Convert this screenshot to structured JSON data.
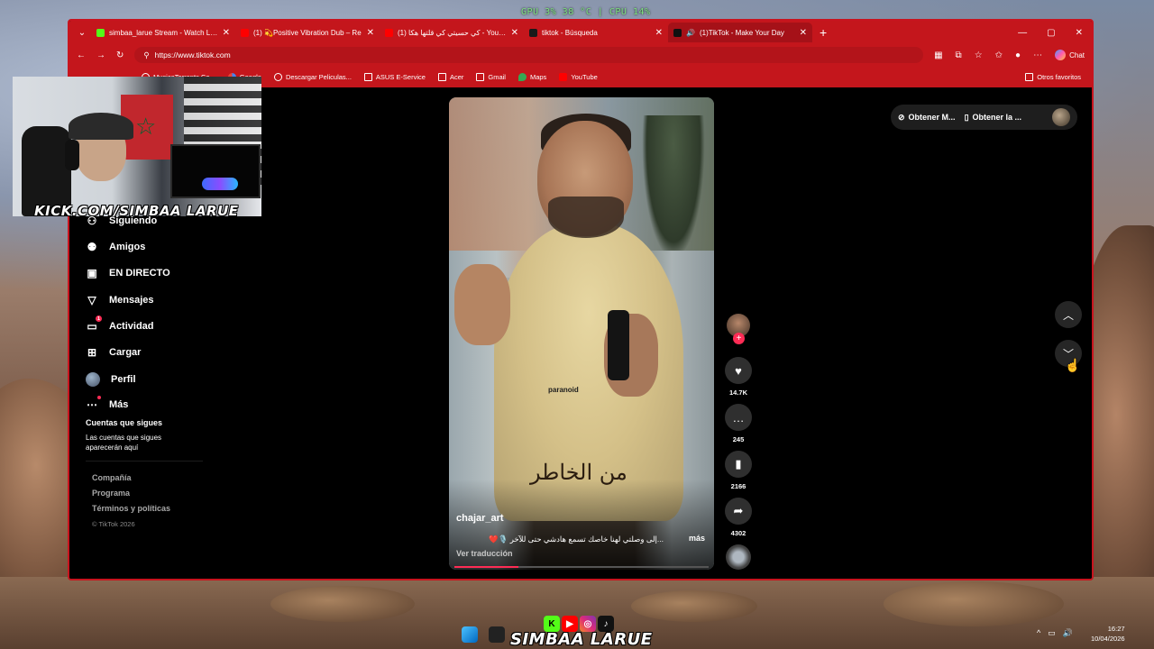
{
  "overlay": {
    "gpu_label": "GPU",
    "gpu_value": "3%",
    "gpu_temp": "38 °C",
    "cpu_label": "CPU",
    "cpu_value": "14%"
  },
  "browser": {
    "tabs": [
      {
        "title": "simbaa_larue Stream - Watch Live",
        "color": "#53fc18"
      },
      {
        "title": "(1) 💫Positive Vibration Dub – Re",
        "color": "#ff0000"
      },
      {
        "title": "(1) كي حسيتي كي قلتها هكا - YouTube",
        "color": "#ff0000"
      },
      {
        "title": "tiktok - Búsqueda",
        "color": "#1a1a1a"
      },
      {
        "title": "(1)TikTok - Make Your Day",
        "color": "#111111"
      }
    ],
    "url": "https://www.tiktok.com",
    "chat_label": "Chat",
    "bookmarks": [
      {
        "label": "MusicaTorrents.Co...",
        "icon": "globe-icon"
      },
      {
        "label": "Google",
        "icon": "google-icon"
      },
      {
        "label": "Descargar Peliculas...",
        "icon": "globe-icon"
      },
      {
        "label": "ASUS E-Service",
        "icon": "folder-icon"
      },
      {
        "label": "Acer",
        "icon": "folder-icon"
      },
      {
        "label": "Gmail",
        "icon": "folder-icon"
      },
      {
        "label": "Maps",
        "icon": "maps-icon"
      },
      {
        "label": "YouTube",
        "icon": "youtube-icon"
      }
    ],
    "other_favorites": "Otros favoritos"
  },
  "sidebar": {
    "items": [
      {
        "label": "Siguiendo",
        "icon": "following-icon"
      },
      {
        "label": "Amigos",
        "icon": "friends-icon"
      },
      {
        "label": "EN DIRECTO",
        "icon": "live-icon"
      },
      {
        "label": "Mensajes",
        "icon": "messages-icon"
      },
      {
        "label": "Actividad",
        "icon": "activity-icon",
        "badge": "1"
      },
      {
        "label": "Cargar",
        "icon": "upload-icon"
      },
      {
        "label": "Perfil",
        "icon": "profile-avatar"
      },
      {
        "label": "Más",
        "icon": "more-icon"
      }
    ],
    "following_title": "Cuentas que sigues",
    "following_note": "Las cuentas que sigues aparecerán aquí",
    "footer_links": [
      "Compañía",
      "Programa",
      "Términos y políticas"
    ],
    "copyright": "© TikTok 2026"
  },
  "video": {
    "author": "chajar_art",
    "caption": "...إلى وصلتي لهنا خاصك تسمع هادشي حتى للآخر 🎙️❤️",
    "more_label": "más",
    "translate_label": "Ver traducción",
    "overlay_text": "من الخاطر",
    "brand_text": "paranoid",
    "progress": 0.25
  },
  "actions": {
    "likes": "14.7K",
    "comments": "245",
    "saves": "2166",
    "shares": "4302"
  },
  "top_right": {
    "get_app_1": "Obtener M...",
    "get_app_2": "Obtener la ..."
  },
  "webcam": {
    "channel": "KICK.COM/SIMBAA LARUE"
  },
  "taskbar": {
    "streamer": "SIMBAA LARUE",
    "time": "16:27",
    "date": "10/04/2026"
  }
}
